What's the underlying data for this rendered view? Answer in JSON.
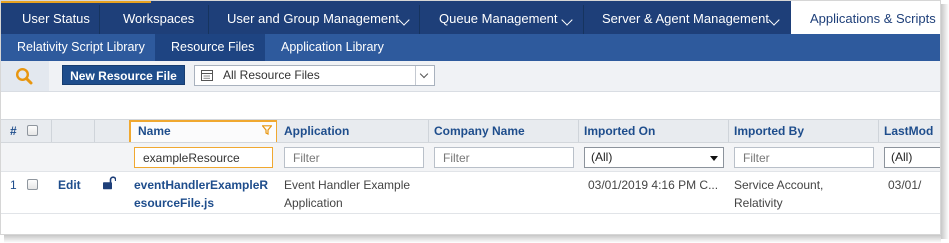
{
  "nav": {
    "tabs": [
      {
        "label": "User Status",
        "active": false,
        "has_dropdown": false
      },
      {
        "label": "Workspaces",
        "active": false,
        "has_dropdown": false
      },
      {
        "label": "User and Group Management",
        "active": false,
        "has_dropdown": true
      },
      {
        "label": "Queue Management",
        "active": false,
        "has_dropdown": true
      },
      {
        "label": "Server & Agent Management",
        "active": false,
        "has_dropdown": true
      },
      {
        "label": "Applications & Scripts",
        "active": true,
        "has_dropdown": false
      }
    ],
    "subtabs": [
      {
        "label": "Relativity Script Library",
        "active": false
      },
      {
        "label": "Resource Files",
        "active": true
      },
      {
        "label": "Application Library",
        "active": false
      }
    ]
  },
  "toolbar": {
    "search_icon": "magnifier-icon",
    "new_button_label": "New Resource File",
    "view_selector_value": "All Resource Files"
  },
  "grid": {
    "columns": {
      "number": "#",
      "name": "Name",
      "application": "Application",
      "company_name": "Company Name",
      "imported_on": "Imported On",
      "imported_by": "Imported By",
      "last_modified": "LastMod"
    },
    "filters": {
      "name_value": "exampleResource",
      "application_placeholder": "Filter",
      "company_placeholder": "Filter",
      "imported_on_value": "(All)",
      "imported_by_placeholder": "Filter",
      "last_modified_value": "(All)"
    },
    "rows": [
      {
        "number": "1",
        "edit_label": "Edit",
        "lock_icon": "unlocked-padlock-icon",
        "name_line1": "eventHandlerExampleR",
        "name_line2": "esourceFile.js",
        "application_line1": "Event Handler Example",
        "application_line2": "Application",
        "imported_on": "03/01/2019 4:16 PM C...",
        "imported_by_line1": "Service Account,",
        "imported_by_line2": "Relativity",
        "last_modified": "03/01/"
      }
    ]
  },
  "colors": {
    "top_nav_bg": "#1e3f79",
    "sub_nav_bg": "#2e5a9d",
    "accent_orange": "#f0a830",
    "link_blue": "#1e4d8c"
  }
}
